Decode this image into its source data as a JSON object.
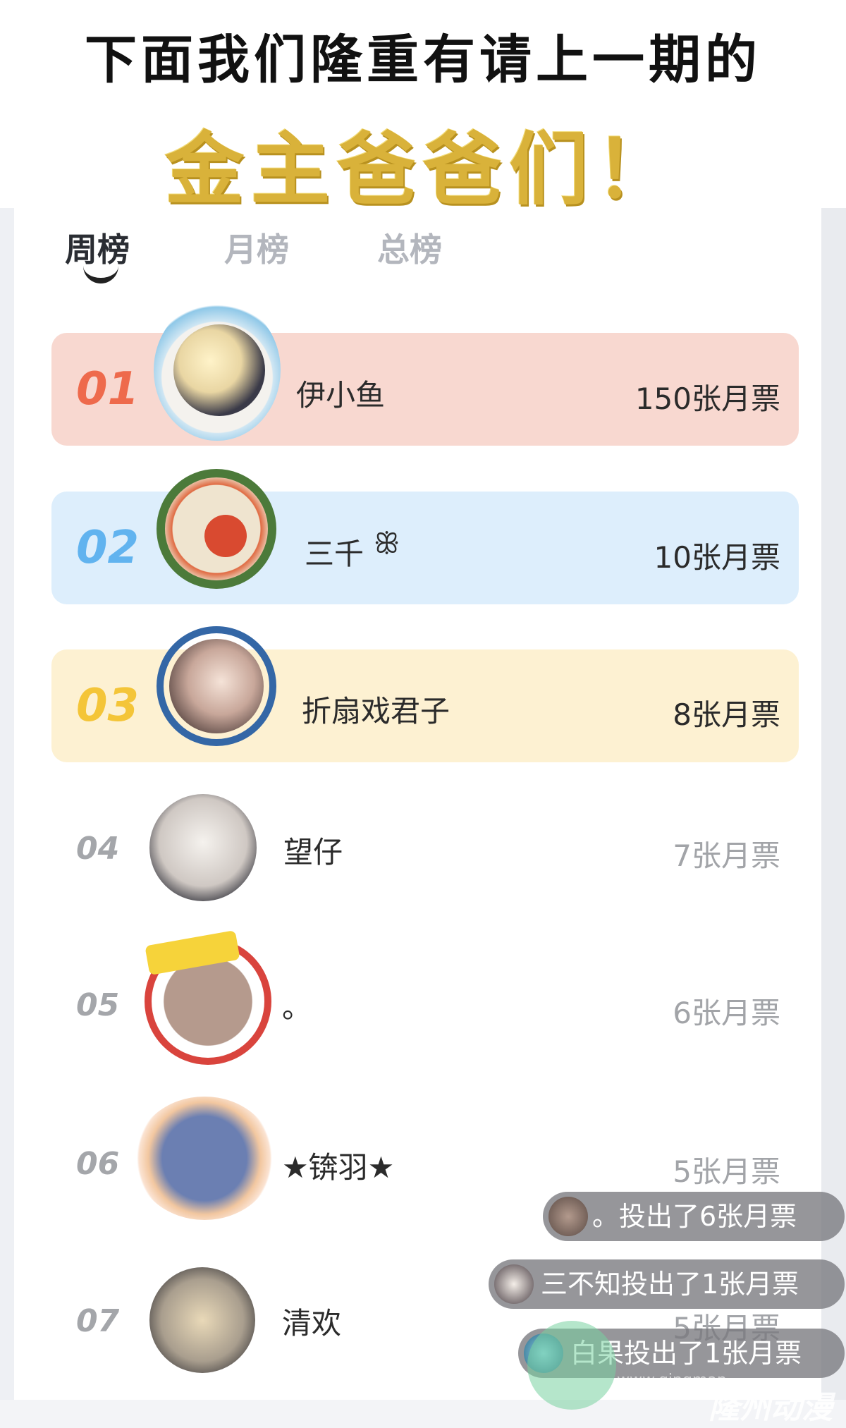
{
  "banner": {
    "headline": "下面我们隆重有请上一期的",
    "subline": "金主爸爸们！"
  },
  "tabs": [
    {
      "label": "周榜",
      "active": true
    },
    {
      "label": "月榜",
      "active": false
    },
    {
      "label": "总榜",
      "active": false
    }
  ],
  "ranking": [
    {
      "rank": "01",
      "name": "伊小鱼",
      "votes": "150张月票",
      "color": "#ee6a4c"
    },
    {
      "rank": "02",
      "name": "三千",
      "votes": "10张月票",
      "color": "#61b3ef"
    },
    {
      "rank": "03",
      "name": "折扇戏君子",
      "votes": "8张月票",
      "color": "#f4c538"
    },
    {
      "rank": "04",
      "name": "望仔",
      "votes": "7张月票"
    },
    {
      "rank": "05",
      "name": "。",
      "votes": "6张月票"
    },
    {
      "rank": "06",
      "name": "★锛羽★",
      "votes": "5张月票"
    },
    {
      "rank": "07",
      "name": "清欢",
      "votes": "5张月票"
    }
  ],
  "toasts": [
    "。投出了6张月票",
    "三不知投出了1张月票",
    "白果投出了1张月票"
  ],
  "watermark": {
    "url": "www.qingman...",
    "logo": "隆州动漫"
  }
}
